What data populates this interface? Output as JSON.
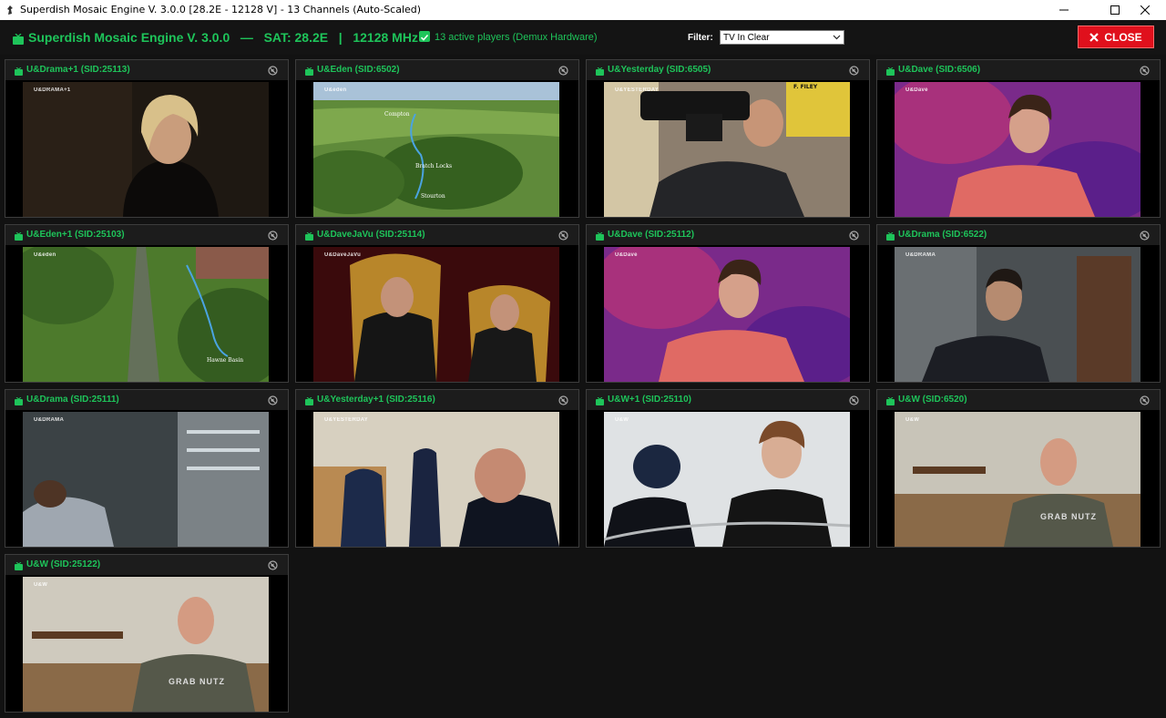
{
  "window": {
    "title": "Superdish Mosaic Engine V. 3.0.0 [28.2E - 12128 V] - 13 Channels (Auto-Scaled)"
  },
  "header": {
    "title": "Superdish Mosaic Engine V. 3.0.0   —   SAT: 28.2E   |   12128 MHz V",
    "status": "13 active players (Demux Hardware)",
    "filter_label": "Filter:",
    "filter_value": "TV In Clear",
    "close_label": "CLOSE",
    "accent": "#1ec45a",
    "close_color": "#e0101c"
  },
  "channels": [
    {
      "name": "U&Drama+1 (SID:25113)",
      "logo": "U&DRAMA+1"
    },
    {
      "name": "U&Eden (SID:6502)",
      "logo": "U&eden",
      "captions": [
        "Compton",
        "Bratch Locks",
        "Stourton"
      ]
    },
    {
      "name": "U&Yesterday (SID:6505)",
      "logo": "U&YESTERDAY",
      "sign": "F. FILEY"
    },
    {
      "name": "U&Dave (SID:6506)",
      "logo": "U&Dave"
    },
    {
      "name": "U&Eden+1 (SID:25103)",
      "logo": "U&eden",
      "captions": [
        "Hawne Basin"
      ]
    },
    {
      "name": "U&DaveJaVu (SID:25114)",
      "logo": "U&DaveJaVu"
    },
    {
      "name": "U&Dave (SID:25112)",
      "logo": "U&Dave"
    },
    {
      "name": "U&Drama (SID:6522)",
      "logo": "U&DRAMA"
    },
    {
      "name": "U&Drama (SID:25111)",
      "logo": "U&DRAMA"
    },
    {
      "name": "U&Yesterday+1 (SID:25116)",
      "logo": "U&YESTERDAY"
    },
    {
      "name": "U&W+1 (SID:25110)",
      "logo": "U&W"
    },
    {
      "name": "U&W (SID:6520)",
      "logo": "U&W",
      "shirt": "GRAB NUTZ"
    },
    {
      "name": "U&W (SID:25122)",
      "logo": "U&W",
      "shirt": "GRAB NUTZ"
    }
  ]
}
